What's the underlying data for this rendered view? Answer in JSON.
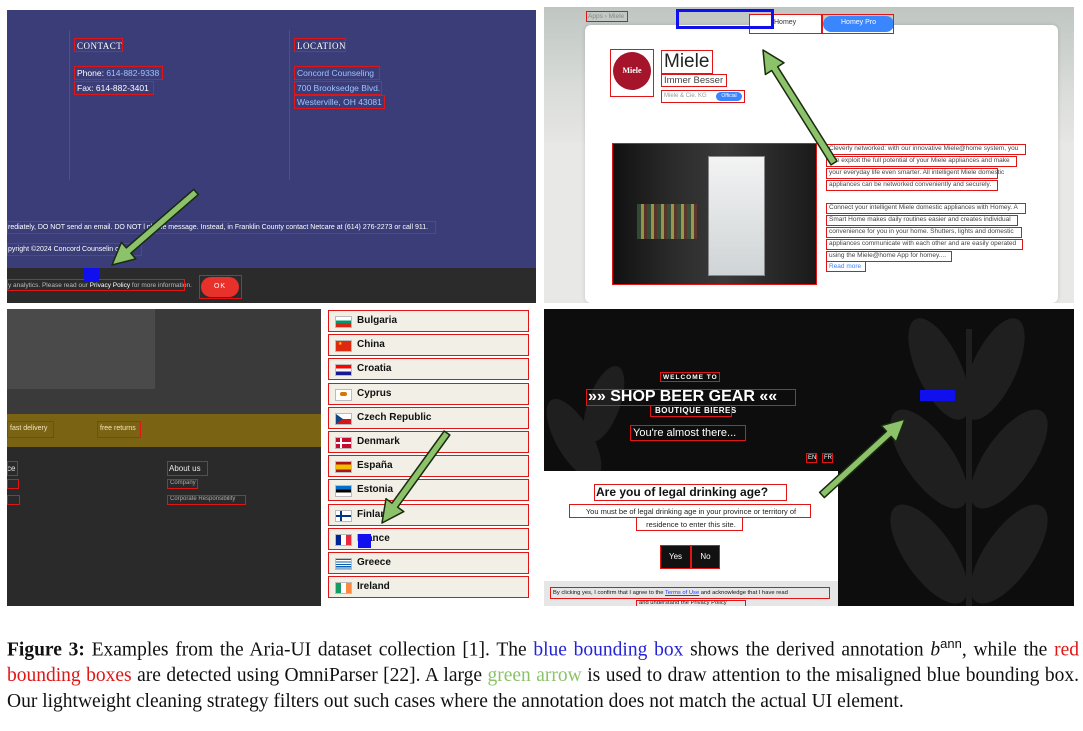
{
  "panel1": {
    "contact_heading": "CONTACT",
    "phone_label": "Phone: ",
    "phone_number": "614-882-9338",
    "fax": "Fax: 614-882-3401",
    "location_heading": "LOCATION",
    "location_name": "Concord Counseling",
    "address1": "700 Brooksedge Blvd.",
    "address2": "Westerville, OH 43081",
    "warning": "rediately, DO NOT send an email. DO NOT l      phone message. Instead, in Franklin County contact Netcare at (614) 276-2273 or call 911.",
    "copyright": "pyright ©2024 Concord Counselin      ces",
    "cookie_prefix": "y analytics. Please read our ",
    "privacy_link": "Privacy Policy",
    "cookie_suffix": " for more information.",
    "ok_button": "OK"
  },
  "panel2": {
    "breadcrumb": "Apps › Miele",
    "tab_homey": "Homey",
    "tab_homey_pro": "Homey Pro",
    "logo_text": "Miele",
    "app_name": "Miele",
    "tagline": "Immer Besser",
    "publisher": "Miele & Cie. KG",
    "official_badge": "Official",
    "desc_para1": [
      "Cleverly networked: with our innovative Miele@home system, you",
      "can exploit the full potential of your Miele appliances and make",
      "your everyday life even smarter. All intelligent Miele domestic",
      "appliances can be networked conveniently and securely."
    ],
    "desc_para2": [
      "Connect your intelligent Miele domestic appliances with Homey. A",
      "Smart Home makes daily routines easier and creates individual",
      "convenience for you in your home. Shutters, lights and domestic",
      "appliances communicate with each other and are easily operated",
      "using the Miele@home App for homey...."
    ],
    "read_more": "Read more"
  },
  "panel3": {
    "fast_delivery": "fast delivery",
    "free_returns": "free returns",
    "left_item": "ce",
    "about_us": "About us",
    "sub_link": "Company",
    "responsibility": "Corporate Responsibility"
  },
  "panel4": {
    "countries": [
      {
        "name": "Bulgaria",
        "flag": "bulgaria"
      },
      {
        "name": "China",
        "flag": "china"
      },
      {
        "name": "Croatia",
        "flag": "croatia"
      },
      {
        "name": "Cyprus",
        "flag": "cyprus"
      },
      {
        "name": "Czech Republic",
        "flag": "czech"
      },
      {
        "name": "Denmark",
        "flag": "denmark"
      },
      {
        "name": "España",
        "flag": "spain"
      },
      {
        "name": "Estonia",
        "flag": "estonia"
      },
      {
        "name": "Finland",
        "flag": "finland"
      },
      {
        "name": "France",
        "flag": "france"
      },
      {
        "name": "Greece",
        "flag": "greece"
      },
      {
        "name": "Ireland",
        "flag": "ireland"
      }
    ]
  },
  "panel5": {
    "welcome": "WELCOME TO",
    "brand": "SHOP BEER GEAR",
    "sub_brand": "BOUTIQUE BIERES",
    "almost_there": "You're almost there...",
    "lang_en": "EN",
    "lang_fr": "FR",
    "age_question": "Are you of legal drinking age?",
    "age_note": "You must be of legal drinking age in your province or territory of residence to enter this site.",
    "yes_button": "Yes",
    "no_button": "No",
    "terms_prefix": "By clicking yes, I confirm that I agree to the ",
    "terms_link": "Terms of Use",
    "terms_suffix": " and acknowledge that I have read",
    "terms_line2": "and understand the Privacy Policy"
  },
  "caption": {
    "figure_label": "Figure 3:",
    "part1": " Examples from the Aria-UI dataset collection [1]. The ",
    "blue_text": "blue bounding box",
    "part2": " shows the derived annotation ",
    "symbol_b": "b",
    "symbol_sup": "ann",
    "part3": ", while the ",
    "red_text": "red bounding boxes",
    "part4": " are detected using OmniParser [22]. A large ",
    "green_text": "green arrow",
    "part5": " is used to draw attention to the misaligned blue bounding box. Our lightweight cleaning strategy filters out such cases where the annotation does not match the actual UI element."
  },
  "colors": {
    "blue_box": "#1010ee",
    "red_box": "#e01515",
    "green_arrow": "#8cc26a"
  }
}
